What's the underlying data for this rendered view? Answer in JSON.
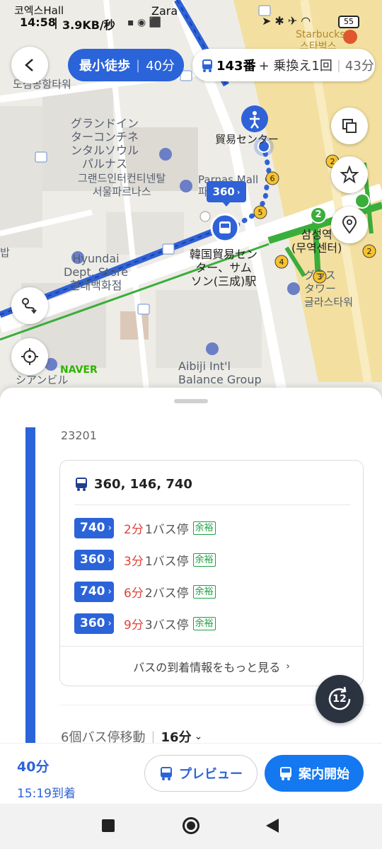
{
  "status_bar": {
    "carrier": "코엑스Hall",
    "time": "14:58",
    "speed": "3.9KB/秒",
    "zara": "Zara",
    "battery": "55"
  },
  "route_header": {
    "mode_label": "最小徒歩",
    "mode_time": "40分",
    "alt_bus": "143番",
    "alt_transfer": "+ 乗換え1回",
    "alt_time": "43分"
  },
  "map_labels": {
    "starbucks": "Starbucks",
    "starbucks_ko": "스타벅스",
    "coex_jp": "グランドイン\nターコンチネ\nンタルソウル\nパルナス",
    "coex_ko": "그랜드인터컨티넨탈\n서울파르나스",
    "tower_ko": "도심공항타워",
    "parnas": "Parnas Mall",
    "parnas_ko": "파르",
    "trade_center": "貿易センター",
    "bus_stop": "韓国貿易セン\nター、サム\nソン(三成)駅",
    "samsung_station": "삼성역\n(무역센터)",
    "hyundai": "Hyundai\nDept. Store\n현대백화점",
    "glass_tower": "グラス\nタワー\n글라스타워",
    "aibiji": "Aibiji Int'l\nBalance Group",
    "naver": "NAVER",
    "bap": "밥",
    "sian": "シアンビル",
    "sidebar_text_1": "ト",
    "bus_label": "360",
    "exit_6": "6",
    "exit_5": "5",
    "exit_4": "4",
    "exit_3": "3",
    "exit_2a": "2",
    "exit_2b": "2",
    "line2": "2",
    "rotate_label": "12"
  },
  "sheet": {
    "stop_id": "23201",
    "routes_title": "360, 146, 740",
    "arrivals": [
      {
        "bus": "740",
        "minutes": "2分",
        "stops": "1バス停",
        "status": "余裕"
      },
      {
        "bus": "360",
        "minutes": "3分",
        "stops": "1バス停",
        "status": "余裕"
      },
      {
        "bus": "740",
        "minutes": "6分",
        "stops": "2バス停",
        "status": "余裕"
      },
      {
        "bus": "360",
        "minutes": "9分",
        "stops": "3バス停",
        "status": "余裕"
      }
    ],
    "more_link": "バスの到着情報をもっと見る",
    "move_label": "6個バス停移動",
    "move_time": "16分"
  },
  "bottom": {
    "total_time": "40分",
    "arrival": "15:19到着",
    "preview": "プレビュー",
    "start": "案内開始"
  },
  "colors": {
    "accent": "#2b63d9",
    "route_blue": "#2f62d6",
    "subway_green": "#3aae3a",
    "red": "#e0433a"
  }
}
